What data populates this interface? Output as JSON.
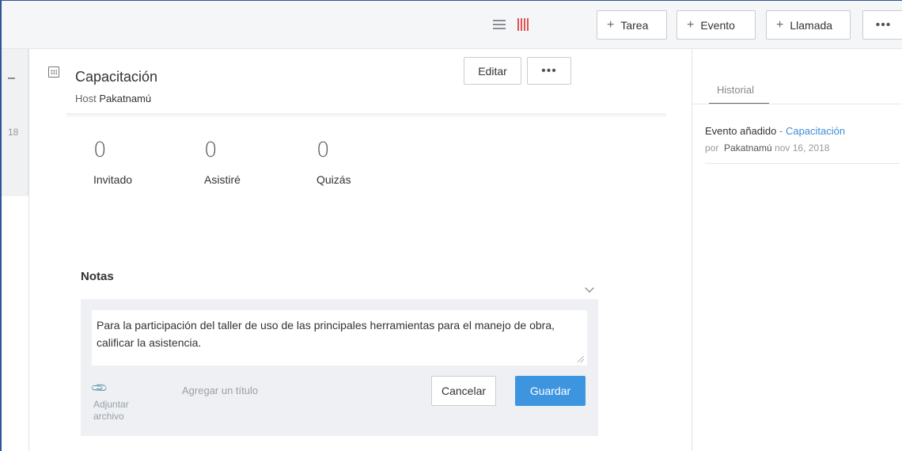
{
  "toolbar": {
    "add_task": "Tarea",
    "add_event": "Evento",
    "add_call": "Llamada",
    "more": "•••"
  },
  "left_strip": {
    "fragment": "–",
    "date_fragment": "18"
  },
  "event": {
    "title": "Capacitación",
    "host_label": "Host",
    "host_name": "Pakatnamú",
    "edit_label": "Editar",
    "more": "•••"
  },
  "rsvp": [
    {
      "count": "0",
      "label": "Invitado"
    },
    {
      "count": "0",
      "label": "Asistiré"
    },
    {
      "count": "0",
      "label": "Quizás"
    }
  ],
  "notes": {
    "title": "Notas",
    "text": "Para la participación del taller de uso de las principales herramientas para el manejo de obra, calificar la asistencia.",
    "attach_label": "Adjuntar archivo",
    "add_title_placeholder": "Agregar un título",
    "cancel_label": "Cancelar",
    "save_label": "Guardar",
    "save_color": "#3e95df"
  },
  "history": {
    "tab_label": "Historial",
    "entry_action": "Evento añadido",
    "entry_separator": "-",
    "entry_link": "Capacitación",
    "entry_by": "por",
    "entry_user": "Pakatnamú",
    "entry_date": "nov 16, 2018"
  }
}
